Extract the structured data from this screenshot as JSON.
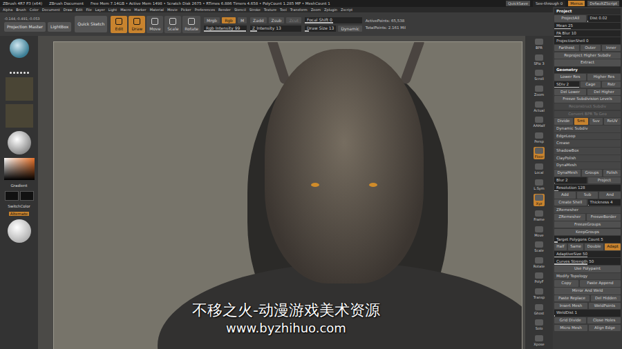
{
  "title_bar": {
    "items": [
      "ZBrush 4R7 P3 (x64)",
      "ZBrush Document",
      "Free Mem 7.14GB • Active Mem 1498 • Scratch Disk 2675 • RTimes 6.886 Timers 4.658 • PolyCount 1.285 MP • MeshCount 1"
    ],
    "quicksave": "QuickSave",
    "see_through": {
      "label": "See-through 0",
      "level": 0
    },
    "toggles": [
      {
        "label": "Menus",
        "selected": true
      },
      {
        "label": "DefaultZScript",
        "selected": false
      }
    ]
  },
  "menu_bar": [
    "Alpha",
    "Brush",
    "Color",
    "Document",
    "Draw",
    "Edit",
    "File",
    "Layer",
    "Light",
    "Macro",
    "Marker",
    "Material",
    "Movie",
    "Picker",
    "Preferences",
    "Render",
    "Stencil",
    "Stroke",
    "Texture",
    "Tool",
    "Transform",
    "Zoom",
    "Zplugin",
    "Zscript"
  ],
  "toolbar": {
    "coords": "-0.144,-0.491,-0.053",
    "left_buttons": [
      "Projection Master",
      "LightBox"
    ],
    "quick_sketch": "Quick Sketch",
    "modes": [
      {
        "label": "Edit",
        "selected": true
      },
      {
        "label": "Draw",
        "selected": true
      },
      {
        "label": "Move",
        "selected": false
      },
      {
        "label": "Scale",
        "selected": false
      },
      {
        "label": "Rotate",
        "selected": false
      }
    ],
    "color_toggles": [
      {
        "label": "Mrgb",
        "selected": false,
        "disabled": false
      },
      {
        "label": "Rgb",
        "selected": true,
        "disabled": false
      },
      {
        "label": "M",
        "selected": false,
        "disabled": false
      }
    ],
    "rgb_intensity": {
      "label": "Rgb Intensity 99",
      "level": 0.99
    },
    "z_toggles": [
      {
        "label": "Zadd",
        "selected": false,
        "disabled": false
      },
      {
        "label": "Zsub",
        "selected": false,
        "disabled": false
      },
      {
        "label": "Zcut",
        "selected": false,
        "disabled": true
      }
    ],
    "z_intensity": {
      "label": "Z Intensity 13",
      "level": 0.13
    },
    "focal_shift": {
      "label": "Focal Shift 0",
      "level": 0.5
    },
    "draw_size": {
      "label": "Draw Size 13",
      "level": 0.13
    },
    "dynamic": {
      "label": "Dynamic",
      "selected": false
    },
    "points": [
      "ActivePoints: 65,538",
      "TotalPoints: 2.161 Mil"
    ]
  },
  "left_tray": {
    "gradient_label": "Gradient",
    "switch_color_label": "SwitchColor",
    "alternate": {
      "label": "Alternate",
      "selected": true
    }
  },
  "viewport": {
    "watermark": [
      "不移之火-动漫游戏美术资源",
      "www.byzhihuo.com"
    ]
  },
  "right_shelf": [
    {
      "label": "BPR",
      "selected": false
    },
    {
      "label": "SPix 3",
      "selected": false
    },
    {
      "label": "Scroll",
      "selected": false
    },
    {
      "label": "Zoom",
      "selected": false
    },
    {
      "label": "Actual",
      "selected": false
    },
    {
      "label": "AAHalf",
      "selected": false
    },
    {
      "label": "Persp",
      "selected": false
    },
    {
      "label": "Floor",
      "selected": true
    },
    {
      "label": "Local",
      "selected": false
    },
    {
      "label": "L.Sym",
      "selected": false
    },
    {
      "label": "Xyz",
      "selected": true
    },
    {
      "label": "Frame",
      "selected": false
    },
    {
      "label": "Move",
      "selected": false
    },
    {
      "label": "Scale",
      "selected": false
    },
    {
      "label": "Rotate",
      "selected": false
    },
    {
      "label": "PolyF",
      "selected": false
    },
    {
      "label": "Transp",
      "selected": false
    },
    {
      "label": "Ghost",
      "selected": false
    },
    {
      "label": "Solo",
      "selected": false
    },
    {
      "label": "Xpose",
      "selected": false
    }
  ],
  "right_panel": {
    "sections": [
      {
        "title": "Project",
        "rows": [
          [
            {
              "label": "ProjectAll",
              "kind": "button",
              "selected": false,
              "disabled": false
            },
            {
              "label": "Dist 0.02",
              "kind": "slider",
              "level": 0.02
            }
          ],
          [
            {
              "label": "Mean 25",
              "kind": "slider",
              "level": 0.25
            }
          ],
          [
            {
              "label": "PA Blur 10",
              "kind": "slider",
              "level": 0.1
            }
          ],
          [
            {
              "label": "ProjectionShell 0",
              "kind": "slider",
              "level": 0
            }
          ],
          [
            {
              "label": "Farthest",
              "kind": "button",
              "selected": false,
              "disabled": false
            },
            {
              "label": "Outer",
              "kind": "button",
              "selected": false,
              "disabled": false
            },
            {
              "label": "Inner",
              "kind": "button",
              "selected": false,
              "disabled": false
            }
          ],
          [
            {
              "label": "Reproject Higher Subdiv",
              "kind": "button",
              "selected": false,
              "disabled": false
            }
          ],
          [
            {
              "label": "Extract",
              "kind": "button",
              "selected": false,
              "disabled": false
            }
          ]
        ]
      },
      {
        "title": "Geometry",
        "rows": [
          [
            {
              "label": "Lower Res",
              "kind": "button",
              "selected": false,
              "disabled": false
            },
            {
              "label": "Higher Res",
              "kind": "button",
              "selected": false,
              "disabled": false
            }
          ],
          [
            {
              "label": "SDiv 2",
              "kind": "slider",
              "level": 1
            },
            {
              "label": "Cage",
              "kind": "button",
              "selected": false,
              "disabled": false
            },
            {
              "label": "Rstr",
              "kind": "button",
              "selected": false,
              "disabled": false
            }
          ],
          [
            {
              "label": "Del Lower",
              "kind": "button",
              "selected": false,
              "disabled": false
            },
            {
              "label": "Del Higher",
              "kind": "button",
              "selected": false,
              "disabled": false
            }
          ],
          [
            {
              "label": "Freeze Subdivision Levels",
              "kind": "button",
              "selected": false,
              "disabled": false
            }
          ],
          [
            {
              "label": "Reconstruct Subdiv",
              "kind": "button",
              "selected": false,
              "disabled": true
            }
          ],
          [
            {
              "label": "Convert BPR To Geo",
              "kind": "button",
              "selected": false,
              "disabled": true
            }
          ],
          [
            {
              "label": "Divide",
              "kind": "button",
              "selected": false,
              "disabled": false
            },
            {
              "label": "Smt",
              "kind": "button",
              "selected": true,
              "disabled": false
            },
            {
              "label": "Suv",
              "kind": "button",
              "selected": false,
              "disabled": false
            },
            {
              "label": "ReUV",
              "kind": "button",
              "selected": false,
              "disabled": false
            }
          ],
          [
            {
              "label": "Dynamic Subdiv",
              "kind": "label"
            }
          ],
          [
            {
              "label": "EdgeLoop",
              "kind": "label"
            }
          ],
          [
            {
              "label": "Crease",
              "kind": "label"
            }
          ],
          [
            {
              "label": "ShadowBox",
              "kind": "label"
            }
          ],
          [
            {
              "label": "ClayPolish",
              "kind": "label"
            }
          ],
          [
            {
              "label": "DynaMesh",
              "kind": "label"
            }
          ],
          [
            {
              "label": "DynaMesh",
              "kind": "button",
              "selected": false,
              "disabled": false
            },
            {
              "label": "Groups",
              "kind": "button",
              "selected": false,
              "disabled": false
            },
            {
              "label": "Polish",
              "kind": "button",
              "selected": false,
              "disabled": false
            }
          ],
          [
            {
              "label": "Blur 2",
              "kind": "slider",
              "level": 0.02
            },
            {
              "label": "Project",
              "kind": "button",
              "selected": false,
              "disabled": false
            }
          ],
          [
            {
              "label": "Resolution 128",
              "kind": "slider",
              "level": 0.06
            }
          ],
          [
            {
              "label": "Add",
              "kind": "button",
              "selected": false,
              "disabled": false
            },
            {
              "label": "Sub",
              "kind": "button",
              "selected": false,
              "disabled": false
            },
            {
              "label": "And",
              "kind": "button",
              "selected": false,
              "disabled": false
            }
          ],
          [
            {
              "label": "Create Shell",
              "kind": "button",
              "selected": false,
              "disabled": false
            },
            {
              "label": "Thickness 4",
              "kind": "slider",
              "level": 0.04
            }
          ],
          [
            {
              "label": "ZRemesher",
              "kind": "label"
            }
          ],
          [
            {
              "label": "ZRemesher",
              "kind": "button",
              "selected": false,
              "disabled": false
            },
            {
              "label": "FreezeBorder",
              "kind": "button",
              "selected": false,
              "disabled": false
            }
          ],
          [
            {
              "label": "FreezeGroups",
              "kind": "button",
              "selected": false,
              "disabled": false
            }
          ],
          [
            {
              "label": "KeepGroups",
              "kind": "button",
              "selected": false,
              "disabled": false
            }
          ],
          [
            {
              "label": "Target Polygons Count 5",
              "kind": "slider",
              "level": 0.05
            }
          ],
          [
            {
              "label": "Half",
              "kind": "button",
              "selected": false,
              "disabled": false
            },
            {
              "label": "Same",
              "kind": "button",
              "selected": false,
              "disabled": false
            },
            {
              "label": "Double",
              "kind": "button",
              "selected": false,
              "disabled": false
            },
            {
              "label": "Adapt",
              "kind": "button",
              "selected": true,
              "disabled": false
            }
          ],
          [
            {
              "label": "AdaptiveSize 50",
              "kind": "slider",
              "level": 0.5
            }
          ],
          [
            {
              "label": "Curves Strength 50",
              "kind": "slider",
              "level": 0.5
            }
          ],
          [
            {
              "label": "Use Polypaint",
              "kind": "button",
              "selected": false,
              "disabled": false
            }
          ],
          [
            {
              "label": "Modify Topology",
              "kind": "label"
            }
          ],
          [
            {
              "label": "Copy",
              "kind": "button",
              "selected": false,
              "disabled": false
            },
            {
              "label": "Paste Append",
              "kind": "button",
              "selected": false,
              "disabled": false
            }
          ],
          [
            {
              "label": "Mirror And Weld",
              "kind": "button",
              "selected": false,
              "disabled": false
            }
          ],
          [
            {
              "label": "Paste Replace",
              "kind": "button",
              "selected": false,
              "disabled": false
            },
            {
              "label": "Del Hidden",
              "kind": "button",
              "selected": false,
              "disabled": false
            }
          ],
          [
            {
              "label": "Insert Mesh",
              "kind": "button",
              "selected": false,
              "disabled": false
            },
            {
              "label": "WeldPoints",
              "kind": "button",
              "selected": false,
              "disabled": false
            }
          ],
          [
            {
              "label": "WeldDist 1",
              "kind": "slider",
              "level": 0.01
            }
          ],
          [
            {
              "label": "Grid Divide",
              "kind": "button",
              "selected": false,
              "disabled": false
            },
            {
              "label": "Close Holes",
              "kind": "button",
              "selected": false,
              "disabled": false
            }
          ],
          [
            {
              "label": "Micro Mesh",
              "kind": "button",
              "selected": false,
              "disabled": false
            },
            {
              "label": "Align Edge",
              "kind": "button",
              "selected": false,
              "disabled": false
            }
          ]
        ]
      }
    ]
  }
}
